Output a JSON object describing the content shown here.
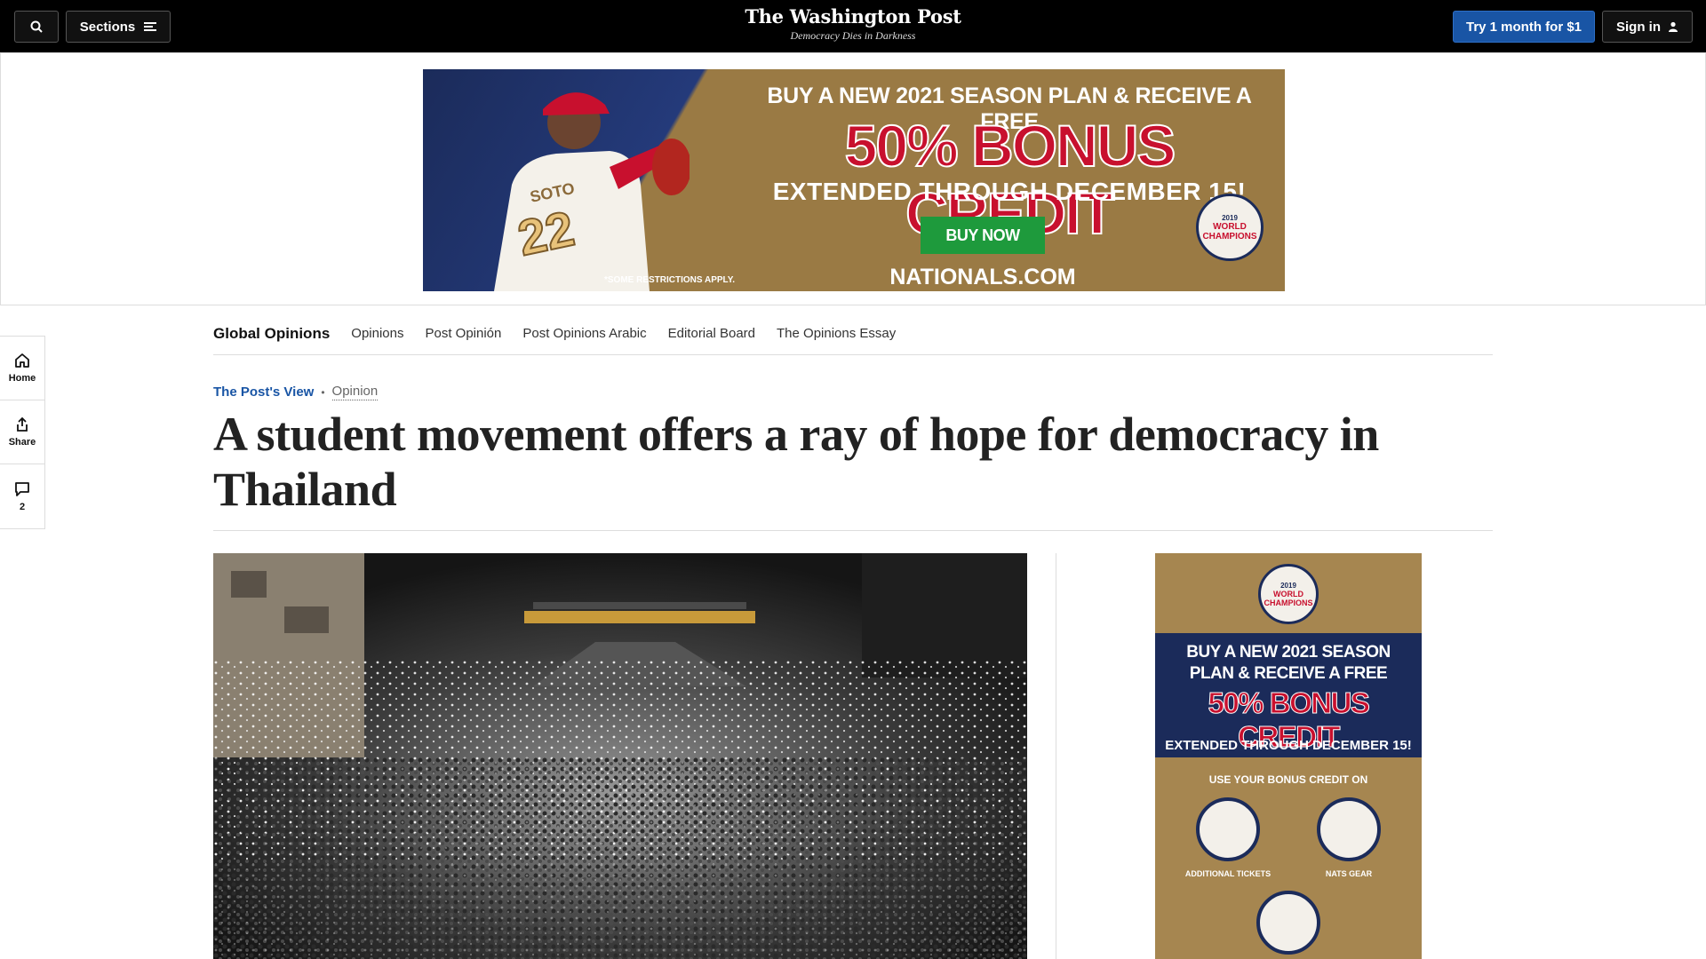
{
  "header": {
    "logo": "The Washington Post",
    "tagline": "Democracy Dies in Darkness",
    "sections_label": "Sections",
    "try_label": "Try 1 month for $1",
    "signin_label": "Sign in"
  },
  "top_ad": {
    "line1": "BUY A NEW 2021 SEASON PLAN & RECEIVE A FREE",
    "line2": "50% BONUS CREDIT",
    "line3": "EXTENDED THROUGH DECEMBER 15!",
    "button": "BUY NOW",
    "restrictions": "*SOME RESTRICTIONS APPLY.",
    "url": "NATIONALS.COM",
    "badge_year": "2019",
    "badge_text": "WORLD CHAMPIONS",
    "jersey_name": "SOTO",
    "jersey_number": "22"
  },
  "subnav": {
    "brand": "Global Opinions",
    "links": [
      "Opinions",
      "Post Opinión",
      "Post Opinions Arabic",
      "Editorial Board",
      "The Opinions Essay"
    ]
  },
  "rail": {
    "home": "Home",
    "share": "Share",
    "comments": "2"
  },
  "article": {
    "kicker": "The Post's View",
    "section": "Opinion",
    "headline": "A student movement offers a ray of hope for democracy in Thailand"
  },
  "side_ad": {
    "badge_year": "2019",
    "badge_text": "WORLD CHAMPIONS",
    "line1": "BUY A NEW 2021 SEASON PLAN & RECEIVE A FREE",
    "line2": "50% BONUS CREDIT",
    "line3": "EXTENDED THROUGH DECEMBER 15!",
    "line4": "USE YOUR BONUS CREDIT ON",
    "cap1": "ADDITIONAL TICKETS",
    "cap2": "NATS GEAR"
  },
  "colors": {
    "accent_blue": "#1955a5",
    "nats_red": "#c8102e",
    "nats_navy": "#1b2b5a",
    "buy_green": "#1e9a3c"
  }
}
